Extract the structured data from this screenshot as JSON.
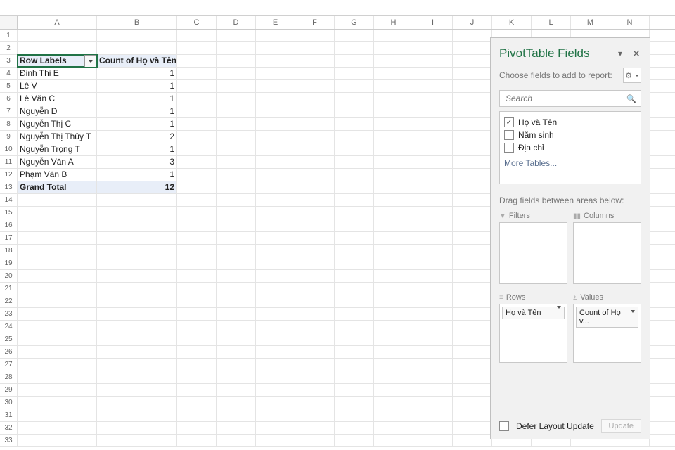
{
  "columns": [
    "A",
    "B",
    "C",
    "D",
    "E",
    "F",
    "G",
    "H",
    "I",
    "J",
    "K",
    "L",
    "M",
    "N"
  ],
  "rows_count": 33,
  "pivot": {
    "header_row": {
      "label": "Row Labels",
      "count_header": "Count of Họ và Tên"
    },
    "data": [
      {
        "label": "Đinh Thị E",
        "count": 1
      },
      {
        "label": "Lê V",
        "count": 1
      },
      {
        "label": "Lê Văn C",
        "count": 1
      },
      {
        "label": "Nguyễn D",
        "count": 1
      },
      {
        "label": "Nguyễn Thị C",
        "count": 1
      },
      {
        "label": "Nguyễn Thị Thủy T",
        "count": 2
      },
      {
        "label": "Nguyễn Trọng T",
        "count": 1
      },
      {
        "label": "Nguyễn Văn A",
        "count": 3
      },
      {
        "label": "Phạm Văn B",
        "count": 1
      }
    ],
    "total": {
      "label": "Grand Total",
      "count": 12
    }
  },
  "pane": {
    "title": "PivotTable Fields",
    "choose_label": "Choose fields to add to report:",
    "search_placeholder": "Search",
    "fields": [
      {
        "label": "Họ và Tên",
        "checked": true
      },
      {
        "label": "Năm sinh",
        "checked": false
      },
      {
        "label": "Địa chỉ",
        "checked": false
      }
    ],
    "more_tables": "More Tables...",
    "drag_label": "Drag fields between areas below:",
    "areas": {
      "filters": "Filters",
      "columns": "Columns",
      "rows": "Rows",
      "values": "Values"
    },
    "rows_chip": "Họ và Tên",
    "values_chip": "Count of Họ v...",
    "defer_label": "Defer Layout Update",
    "update_btn": "Update"
  }
}
